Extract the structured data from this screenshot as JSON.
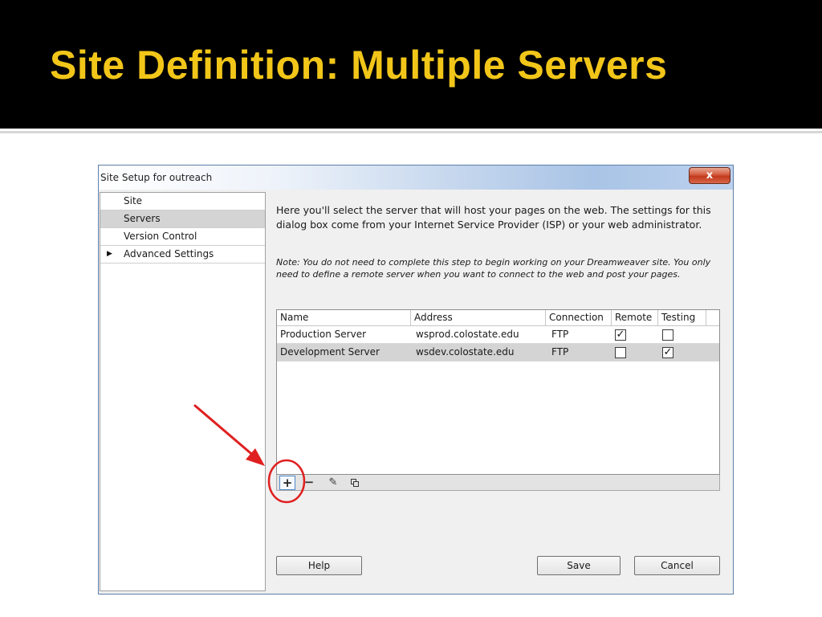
{
  "slide": {
    "title": "Site Definition: Multiple Servers"
  },
  "dialog": {
    "title": "Site Setup for outreach",
    "close_label": "x",
    "nav": [
      {
        "label": "Site",
        "selected": false
      },
      {
        "label": "Servers",
        "selected": true
      },
      {
        "label": "Version Control",
        "selected": false
      },
      {
        "label": "Advanced Settings",
        "selected": false,
        "expand_arrow": "▶"
      }
    ],
    "intro": "Here you'll select the server that will host your pages on the web. The settings for this dialog box come from your Internet Service Provider (ISP) or your web administrator.",
    "note": "Note: You do not need to complete this step to begin working on your Dreamweaver site. You only need to define a remote server when you want to connect to the web and post your pages.",
    "table": {
      "columns": [
        "Name",
        "Address",
        "Connection",
        "Remote",
        "Testing"
      ],
      "rows": [
        {
          "name": "Production Server",
          "address": "wsprod.colostate.edu",
          "connection": "FTP",
          "remote": true,
          "testing": false,
          "selected": false
        },
        {
          "name": "Development Server",
          "address": "wsdev.colostate.edu",
          "connection": "FTP",
          "remote": false,
          "testing": true,
          "selected": true
        }
      ]
    },
    "toolbar": {
      "add_symbol": "+",
      "remove_symbol": "−",
      "edit_symbol": "✎"
    },
    "buttons": {
      "help": "Help",
      "save": "Save",
      "cancel": "Cancel"
    },
    "checkmark": "✓"
  },
  "annotations": {
    "color": "#e02020"
  }
}
